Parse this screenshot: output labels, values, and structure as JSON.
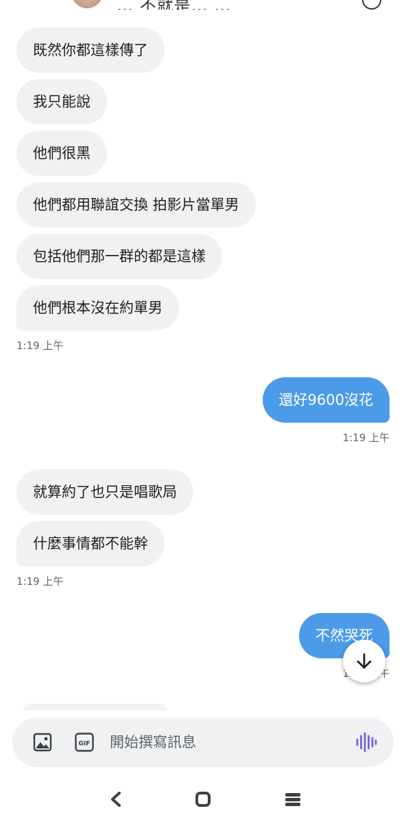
{
  "header": {
    "title_fragment": "… 不就是… …"
  },
  "messages": [
    {
      "text": "既然你都這樣傳了"
    },
    {
      "text": "我只能說"
    },
    {
      "text": "他們很黑"
    },
    {
      "text": "他們都用聯誼交換 拍影片當單男"
    },
    {
      "text": "包括他們那一群的都是這樣"
    },
    {
      "text": "他們根本沒在約單男"
    },
    {
      "text": "還好9600沒花"
    },
    {
      "text": "就算約了也只是唱歌局"
    },
    {
      "text": "什麼事情都不能幹"
    },
    {
      "text": "不然哭死"
    }
  ],
  "timestamps": [
    "1:19 上午",
    "1:19 上午",
    "1:19 上午",
    "1:19 上午"
  ],
  "composer": {
    "placeholder": "開始撰寫訊息",
    "gif_label": "GIF"
  },
  "colors": {
    "outgoing_bubble": "#4c9be8",
    "incoming_bubble": "#eff1f3",
    "mic_accent": "#7b61d6"
  },
  "icons": [
    "image-icon",
    "gif-icon",
    "voice-wave-icon",
    "arrow-down-icon",
    "nav-back-icon",
    "nav-home-icon",
    "nav-recents-icon"
  ]
}
